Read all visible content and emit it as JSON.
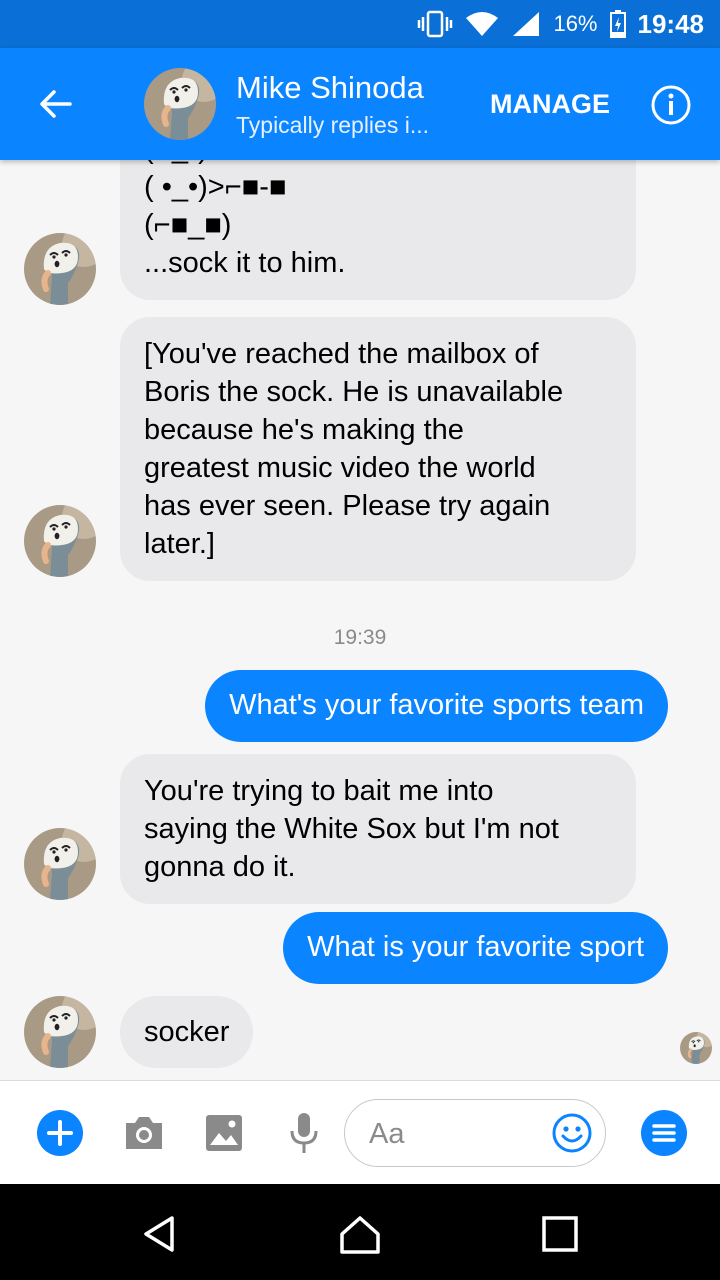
{
  "status_bar": {
    "battery": "16%",
    "time": "19:48"
  },
  "header": {
    "name": "Mike Shinoda",
    "subtitle": "Typically replies i...",
    "manage_label": "MANAGE"
  },
  "messages": [
    {
      "direction": "incoming",
      "lines": [
        "( •_•)",
        "( •_•)>⌐■-■",
        "(⌐■_■)",
        "...sock it to him."
      ]
    },
    {
      "direction": "incoming",
      "lines": [
        "[You've reached the mailbox of",
        "Boris the sock. He is unavailable",
        "because he's making the",
        "greatest music video the world",
        "has ever seen. Please try again",
        "later.]"
      ]
    },
    {
      "timestamp": "19:39"
    },
    {
      "direction": "outgoing",
      "text": "What's your favorite sports team"
    },
    {
      "direction": "incoming",
      "lines": [
        "You're trying to bait me into",
        "saying the White Sox but I'm not",
        "gonna do it."
      ]
    },
    {
      "direction": "outgoing",
      "text": "What is your favorite sport"
    },
    {
      "direction": "incoming",
      "text": "socker"
    }
  ],
  "composer": {
    "placeholder": "Aa"
  },
  "colors": {
    "brand": "#0b84ff",
    "status_bar": "#0a6fd6",
    "incoming_bubble": "#e9e9eb"
  },
  "icons": [
    "back-arrow-icon",
    "info-icon",
    "plus-icon",
    "camera-icon",
    "gallery-icon",
    "microphone-icon",
    "emoji-icon",
    "menu-icon",
    "nav-back-icon",
    "nav-home-icon",
    "nav-recents-icon"
  ]
}
